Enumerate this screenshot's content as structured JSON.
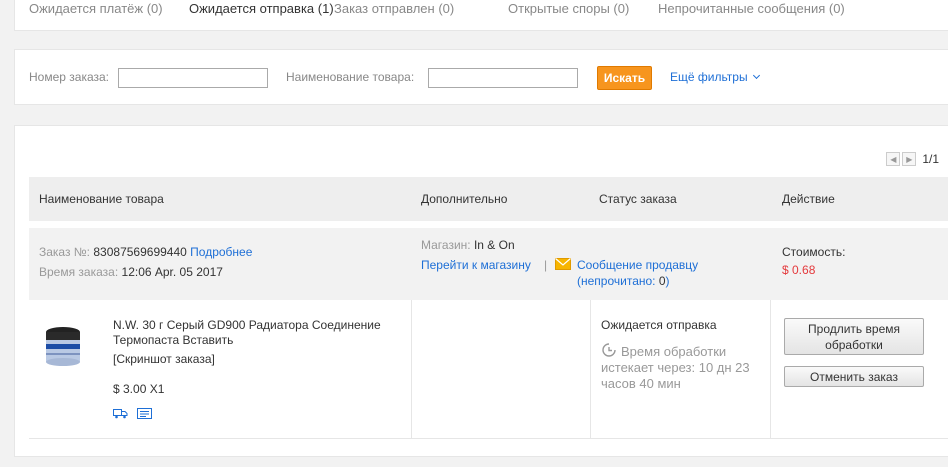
{
  "tabs": [
    {
      "label": "Ожидается платёж (0)",
      "active": false
    },
    {
      "label": "Ожидается отправка (1)",
      "active": true
    },
    {
      "label": "Заказ отправлен (0)",
      "active": false
    },
    {
      "label": "Открытые споры (0)",
      "active": false
    },
    {
      "label": "Непрочитанные сообщения (0)",
      "active": false
    }
  ],
  "search": {
    "order_label": "Номер заказа:",
    "order_value": "",
    "product_label": "Наименование товара:",
    "product_value": "",
    "search_button": "Искать",
    "more_filters": "Ещё фильтры"
  },
  "pager": {
    "pages": "1/1"
  },
  "table": {
    "headers": [
      "Наименование товара",
      "Дополнительно",
      "Статус заказа",
      "Действие"
    ]
  },
  "order": {
    "number_label": "Заказ №:",
    "number": "83087569699440",
    "details_link": "Подробнее",
    "time_label": "Время заказа:",
    "time": "12:06 Apr. 05 2017",
    "store_label": "Магазин:",
    "store": "In & On",
    "go_to_store": "Перейти к магазину",
    "separator": "|",
    "message_seller": "Сообщение продавцу",
    "unread_prefix": "(непрочитано: ",
    "unread_count": "0",
    "unread_suffix": ")",
    "cost_label": "Стоимость:",
    "cost": "$ 0.68"
  },
  "item": {
    "name": "N.W. 30 г Серый GD900 Радиатора Соединение Термопаста Вставить",
    "snapshot": "[Скриншот заказа]",
    "price": "$ 3.00 X1",
    "status": "Ожидается отправка",
    "processing_line1": "Время обработки",
    "processing_line2": "истекает через: 10 дн 23",
    "processing_line3": "часов 40 мин",
    "extend_button_line1": "Продлить время",
    "extend_button_line2": "обработки",
    "cancel_button": "Отменить заказ"
  },
  "colors": {
    "accent": "#f7951e",
    "link": "#1e6fd6",
    "price": "#e4393c"
  }
}
